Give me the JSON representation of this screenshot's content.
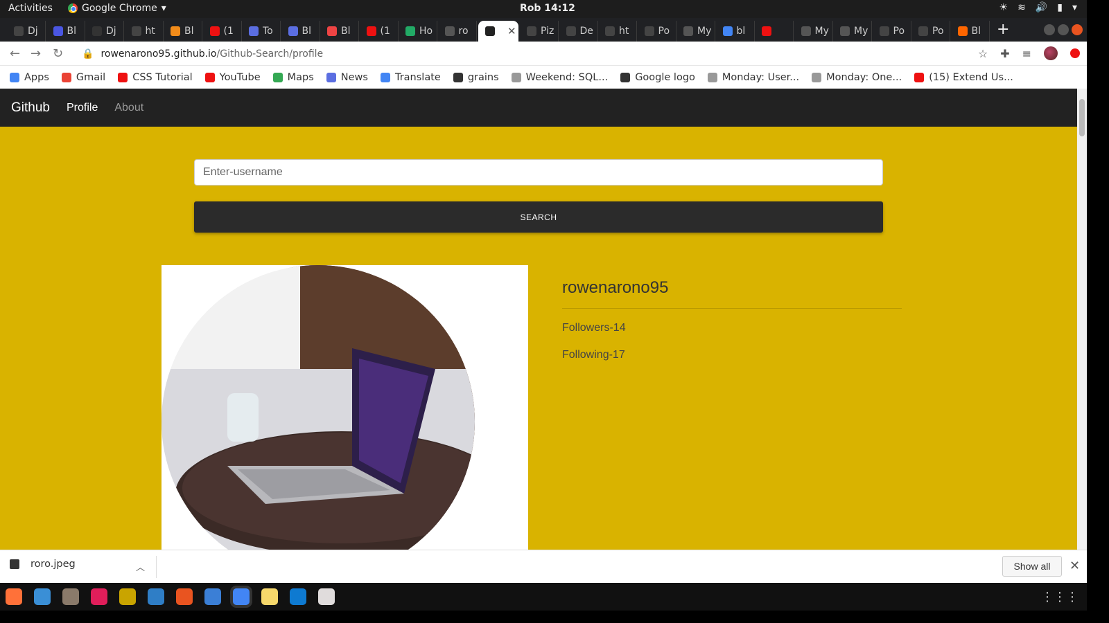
{
  "system": {
    "activities": "Activities",
    "app_name": "Google Chrome",
    "clock": "Rob 14:12"
  },
  "tabs": [
    {
      "label": "Dj",
      "color": "#444"
    },
    {
      "label": "Bl",
      "color": "#4a56e2"
    },
    {
      "label": "Dj",
      "color": "#333"
    },
    {
      "label": "ht",
      "color": "#444"
    },
    {
      "label": "Bl",
      "color": "#f28c1a"
    },
    {
      "label": "(1",
      "color": "#e11"
    },
    {
      "label": "To",
      "color": "#5b6ee1"
    },
    {
      "label": "Bl",
      "color": "#5b6ee1"
    },
    {
      "label": "Bl",
      "color": "#e44"
    },
    {
      "label": "(1",
      "color": "#e11"
    },
    {
      "label": "Ho",
      "color": "#2a6"
    },
    {
      "label": "ro",
      "color": "#555"
    },
    {
      "label": "",
      "color": "#222",
      "active": true
    },
    {
      "label": "Piz",
      "color": "#444"
    },
    {
      "label": "De",
      "color": "#444"
    },
    {
      "label": "ht",
      "color": "#444"
    },
    {
      "label": "Po",
      "color": "#444"
    },
    {
      "label": "My",
      "color": "#555"
    },
    {
      "label": "bl",
      "color": "#4285f4"
    },
    {
      "label": "",
      "color": "#e11"
    },
    {
      "label": "My",
      "color": "#555"
    },
    {
      "label": "My",
      "color": "#555"
    },
    {
      "label": "Po",
      "color": "#444"
    },
    {
      "label": "Po",
      "color": "#444"
    },
    {
      "label": "Bl",
      "color": "#f60"
    }
  ],
  "address": {
    "host": "rowenarono95.github.io",
    "path": "/Github-Search/profile"
  },
  "bookmarks": [
    {
      "label": "Apps",
      "color": "#4285f4"
    },
    {
      "label": "Gmail",
      "color": "#ea4335"
    },
    {
      "label": "CSS Tutorial",
      "color": "#e11"
    },
    {
      "label": "YouTube",
      "color": "#e11"
    },
    {
      "label": "Maps",
      "color": "#34a853"
    },
    {
      "label": "News",
      "color": "#5b6ee1"
    },
    {
      "label": "Translate",
      "color": "#4285f4"
    },
    {
      "label": "grains",
      "color": "#333"
    },
    {
      "label": "Weekend: SQL...",
      "color": "#999"
    },
    {
      "label": "Google logo",
      "color": "#333"
    },
    {
      "label": "Monday: User...",
      "color": "#999"
    },
    {
      "label": "Monday: One...",
      "color": "#999"
    },
    {
      "label": "(15) Extend Us...",
      "color": "#e11"
    }
  ],
  "page": {
    "brand": "Github",
    "nav": [
      {
        "label": "Profile",
        "active": true
      },
      {
        "label": "About",
        "active": false
      }
    ],
    "search_placeholder": "Enter-username",
    "search_button": "SEARCH",
    "profile": {
      "username": "rowenarono95",
      "followers": "Followers-14",
      "following": "Following-17"
    },
    "background_color": "#d9b300"
  },
  "downloads": {
    "file_name": "roro.jpeg",
    "show_all": "Show all"
  },
  "dock_apps": [
    {
      "name": "firefox",
      "color": "#ff7139"
    },
    {
      "name": "thunderbird",
      "color": "#3a8fd6"
    },
    {
      "name": "files",
      "color": "#8a7a6a"
    },
    {
      "name": "slack",
      "color": "#e01e5a"
    },
    {
      "name": "app",
      "color": "#c9a400"
    },
    {
      "name": "writer",
      "color": "#2f7ec6"
    },
    {
      "name": "software",
      "color": "#e95420"
    },
    {
      "name": "help",
      "color": "#3b7fd6"
    },
    {
      "name": "chrome",
      "color": "#4285f4",
      "active": true
    },
    {
      "name": "text-editor",
      "color": "#f6d86b"
    },
    {
      "name": "vscode",
      "color": "#0e7ad1"
    },
    {
      "name": "screenshot",
      "color": "#e0dcdc"
    }
  ]
}
